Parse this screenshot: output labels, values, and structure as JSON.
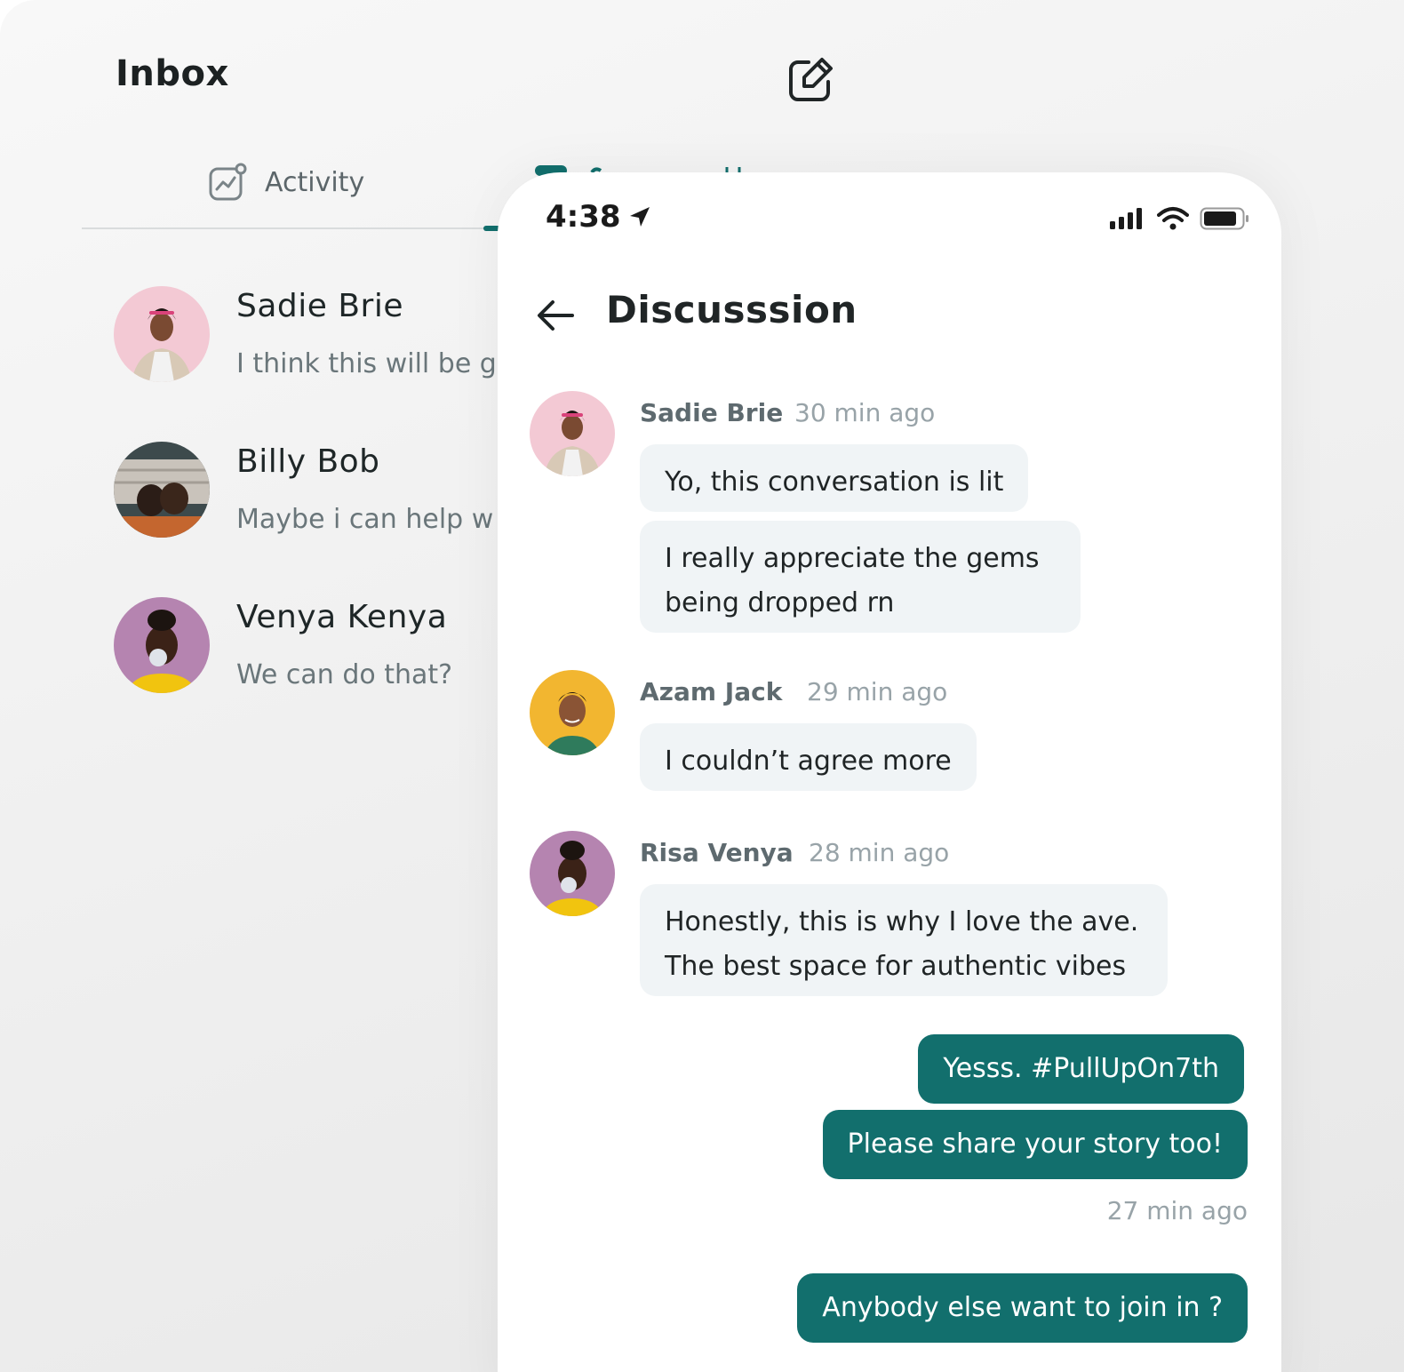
{
  "inbox": {
    "title": "Inbox",
    "tabs": [
      {
        "label": "Activity",
        "icon": "activity-chart-icon"
      },
      {
        "label": "Conversations",
        "icon": "chat-icon"
      }
    ],
    "conversations": [
      {
        "name": "Sadie Brie",
        "preview": "I think this will be g"
      },
      {
        "name": "Billy Bob",
        "preview": "Maybe i can help w"
      },
      {
        "name": "Venya Kenya",
        "preview": "We can do that?"
      }
    ]
  },
  "status_bar": {
    "time": "4:38"
  },
  "discussion": {
    "title": "Discusssion",
    "messages": [
      {
        "author": "Sadie Brie",
        "time": "30 min ago",
        "bubbles": [
          "Yo, this conversation is lit",
          "I really appreciate the gems being dropped rn"
        ]
      },
      {
        "author": "Azam Jack",
        "time": "29 min ago",
        "bubbles": [
          "I couldn’t agree more"
        ]
      },
      {
        "author": "Risa Venya",
        "time": "28 min ago",
        "bubbles": [
          "Honestly, this is why I love the ave. The best space for authentic vibes"
        ]
      }
    ],
    "outgoing": [
      {
        "text": "Yesss. #PullUpOn7th"
      },
      {
        "text": "Please share your story too!"
      },
      {
        "text": "Anybody else want to join in ?"
      }
    ],
    "outgoing_time": "27 min ago"
  },
  "colors": {
    "accent": "#126f6d",
    "bubble_in": "#f0f4f6"
  }
}
